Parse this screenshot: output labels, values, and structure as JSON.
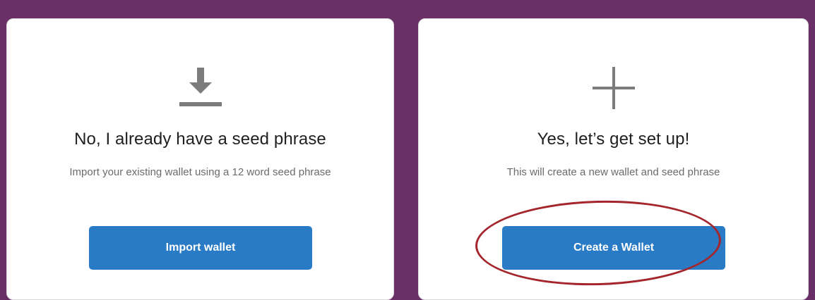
{
  "import_card": {
    "icon": "download-icon",
    "title": "No, I already have a seed phrase",
    "subtitle": "Import your existing wallet using a 12 word seed phrase",
    "button_label": "Import wallet"
  },
  "create_card": {
    "icon": "plus-icon",
    "title": "Yes, let’s get set up!",
    "subtitle": "This will create a new wallet and seed phrase",
    "button_label": "Create a Wallet"
  },
  "colors": {
    "background": "#6a2f66",
    "button": "#2a7bc6",
    "highlight": "#a4262c"
  }
}
